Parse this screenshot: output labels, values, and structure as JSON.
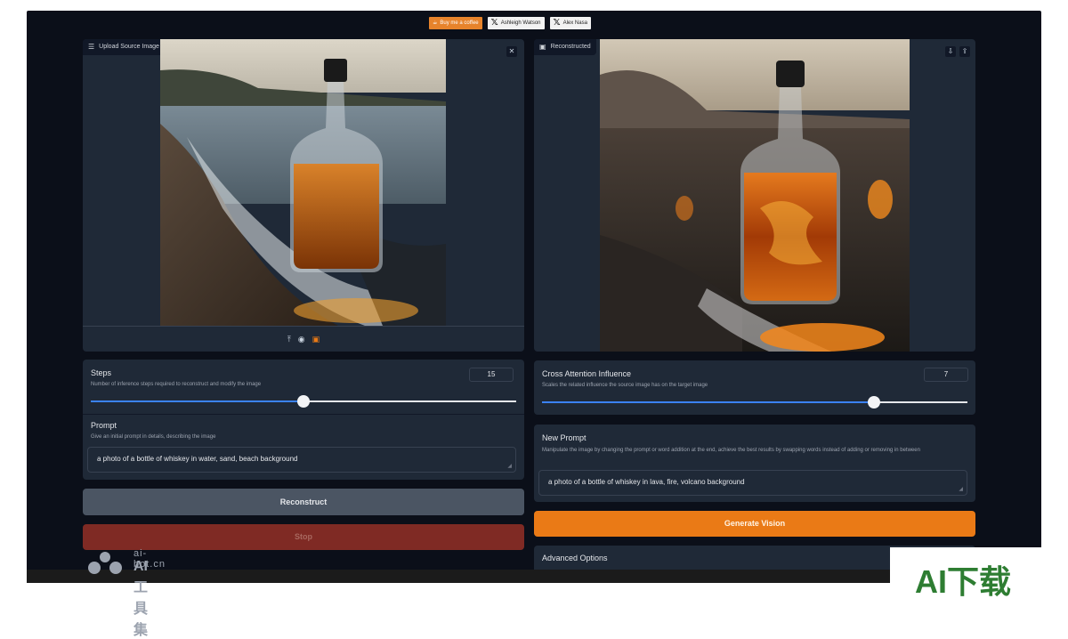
{
  "top_badges": {
    "coffee": "Buy me a coffee",
    "author1": "Ashleigh Watson",
    "author2": "Alex Nasa"
  },
  "source_panel": {
    "label": "Upload Source Image",
    "close_icon": "close-icon",
    "tools": [
      "upload-icon",
      "webcam-icon",
      "clipboard-icon"
    ]
  },
  "reconstructed_panel": {
    "label": "Reconstructed"
  },
  "steps": {
    "title": "Steps",
    "description": "Number of inference steps required to reconstruct and modify the image",
    "value": "15",
    "slider_fraction": 0.5
  },
  "prompt": {
    "title": "Prompt",
    "description": "Give an initial prompt in details, describing the image",
    "value": "a photo of a bottle of whiskey in water, sand, beach background"
  },
  "buttons": {
    "reconstruct": "Reconstruct",
    "stop": "Stop",
    "generate": "Generate Vision"
  },
  "cross_attention": {
    "title": "Cross Attention Influence",
    "description": "Scales the related influence the source image has on the target image",
    "value": "7",
    "slider_fraction": 0.78
  },
  "new_prompt": {
    "title": "New Prompt",
    "description": "Manipulate the image by changing the prompt or word addition at the end, achieve the best results by swapping words instead of adding or removing in between",
    "value": "a photo of a bottle of whiskey in lava, fire, volcano background"
  },
  "advanced": {
    "label": "Advanced Options"
  },
  "watermark": {
    "line1": "ai-bot.cn",
    "line2": "AI工具集"
  },
  "corner_logo": "AI下载",
  "colors": {
    "background": "#0b0f19",
    "panel": "#1f2937",
    "accent_blue": "#3b82f6",
    "generate_orange": "#ea7a16",
    "stop_red": "#7f2a24"
  }
}
